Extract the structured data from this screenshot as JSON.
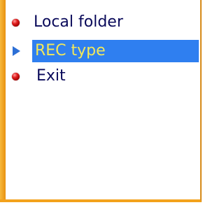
{
  "menu": {
    "items": [
      {
        "label": "Local folder",
        "indicator": "red-bullet",
        "selected": false
      },
      {
        "label": "REC type",
        "indicator": "blue-arrow",
        "selected": true
      },
      {
        "label": "Exit",
        "indicator": "red-bullet",
        "selected": false
      }
    ]
  },
  "colors": {
    "frame": "#f3a21c",
    "selection_bg": "#2f7ff0",
    "selection_text": "#f2e85a",
    "text": "#0a0a5a",
    "bullet": "#e02020",
    "arrow": "#2c6fd6"
  }
}
